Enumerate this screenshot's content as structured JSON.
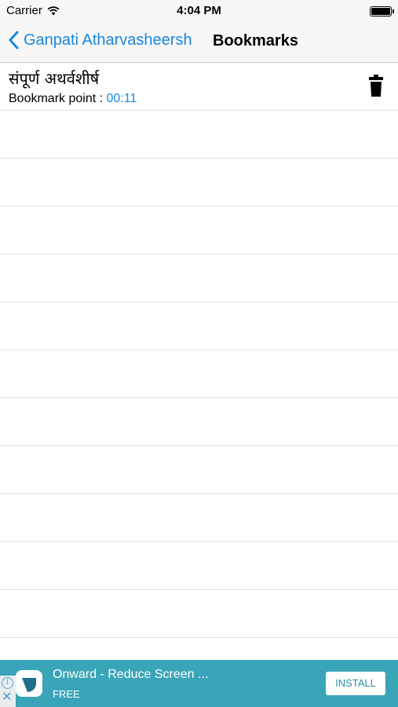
{
  "status_bar": {
    "carrier": "Carrier",
    "time": "4:04 PM",
    "wifi_icon": "wifi-icon",
    "battery_icon": "battery-icon"
  },
  "nav": {
    "back_label": "Ganpati Atharvasheersh",
    "title": "Bookmarks",
    "accent_color": "#1a87e0"
  },
  "bookmarks": [
    {
      "title": "संपूर्ण अथर्वशीर्ष",
      "point_label": "Bookmark point : ",
      "point_time": "00:11",
      "delete_icon": "trash-icon"
    }
  ],
  "ad": {
    "title": "Onward - Reduce Screen ...",
    "subtitle": "FREE",
    "install_label": "INSTALL",
    "info_label": "i",
    "close_label": "✕",
    "background_color": "#3aa5b8"
  }
}
